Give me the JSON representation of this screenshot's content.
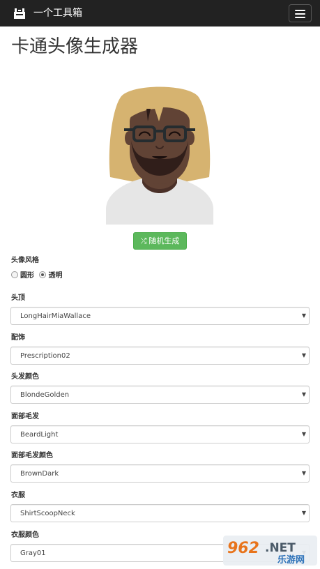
{
  "navbar": {
    "brand": "一个工具箱"
  },
  "page": {
    "title": "卡通头像生成器"
  },
  "random_button": {
    "label": "随机生成"
  },
  "style_section": {
    "label": "头像风格",
    "options": [
      {
        "label": "圆形",
        "checked": false
      },
      {
        "label": "透明",
        "checked": true
      }
    ]
  },
  "fields": [
    {
      "label": "头顶",
      "value": "LongHairMiaWallace"
    },
    {
      "label": "配饰",
      "value": "Prescription02"
    },
    {
      "label": "头发颜色",
      "value": "BlondeGolden"
    },
    {
      "label": "面部毛发",
      "value": "BeardLight"
    },
    {
      "label": "面部毛发颜色",
      "value": "BrownDark"
    },
    {
      "label": "衣服",
      "value": "ShirtScoopNeck"
    },
    {
      "label": "衣服颜色",
      "value": "Gray01"
    }
  ],
  "watermark": {
    "number": "962",
    "suffix": ".NET",
    "sub": "乐游网"
  },
  "colors": {
    "navbar": "#222222",
    "accent_green": "#5cb85c",
    "hair": "#D6B370",
    "skin": "#614335",
    "beard": "#2C1B18",
    "shirt": "#E6E6E6"
  }
}
